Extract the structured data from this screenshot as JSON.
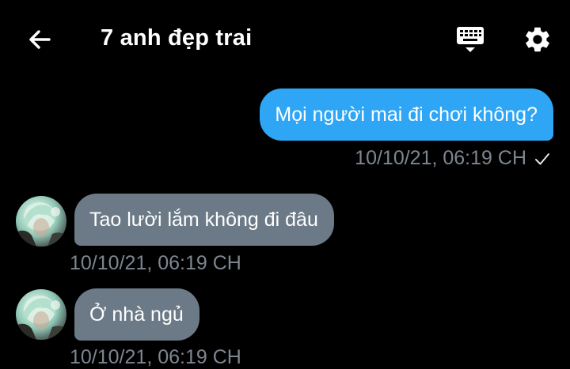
{
  "header": {
    "back_icon": "arrow-left-icon",
    "title": "7 anh đẹp trai",
    "keyboard_icon": "keyboard-icon",
    "settings_icon": "gear-icon"
  },
  "messages": [
    {
      "direction": "outgoing",
      "text": "Mọi người mai đi chơi không?",
      "time": "10/10/21, 06:19 CH",
      "status_icon": "checkmark-icon"
    },
    {
      "direction": "incoming",
      "text": "Tao lười lắm không đi đâu",
      "time": "10/10/21, 06:19 CH"
    },
    {
      "direction": "incoming",
      "text": "Ở nhà ngủ",
      "time": "10/10/21, 06:19 CH"
    }
  ],
  "colors": {
    "background": "#000000",
    "outgoing_bubble": "#2ea6f5",
    "incoming_bubble": "#6c7a87",
    "timestamp": "#7d8691"
  }
}
